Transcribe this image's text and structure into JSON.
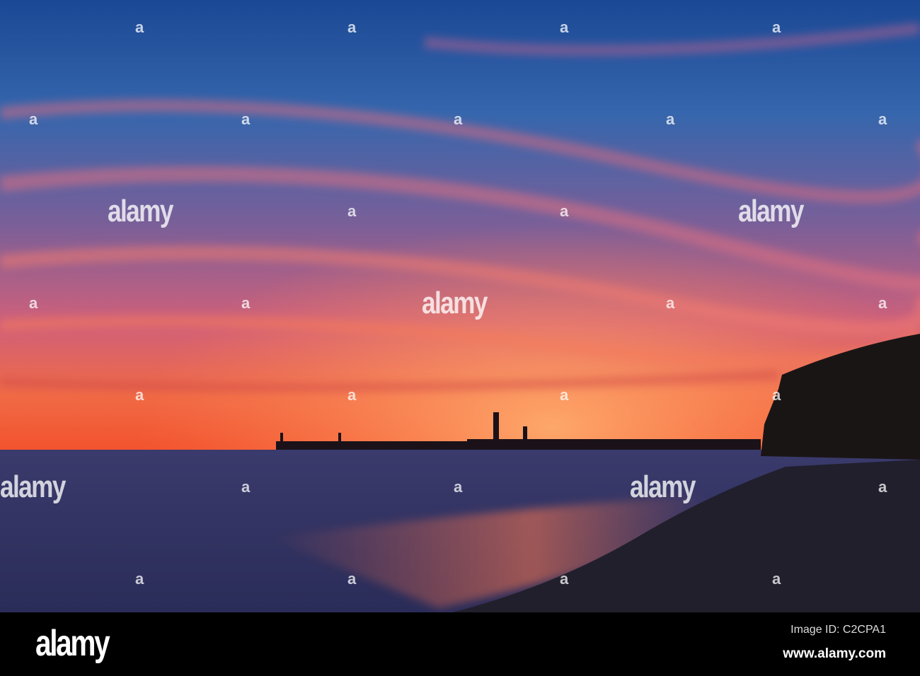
{
  "photo": {
    "subject": "Sunset over sea with pier and lighthouses",
    "colors": {
      "sky_top": "#1d4b98",
      "sky_mid": "#8a5a8e",
      "sky_glow": "#f0603a",
      "sea": "#2e2f5c",
      "beach": "#1f1d2a",
      "cliff": "#1a1414"
    }
  },
  "watermark": {
    "text": "alamy",
    "mark": "a"
  },
  "footer": {
    "logo": "alamy",
    "image_id": "Image ID: C2CPA1",
    "website": "www.alamy.com"
  }
}
